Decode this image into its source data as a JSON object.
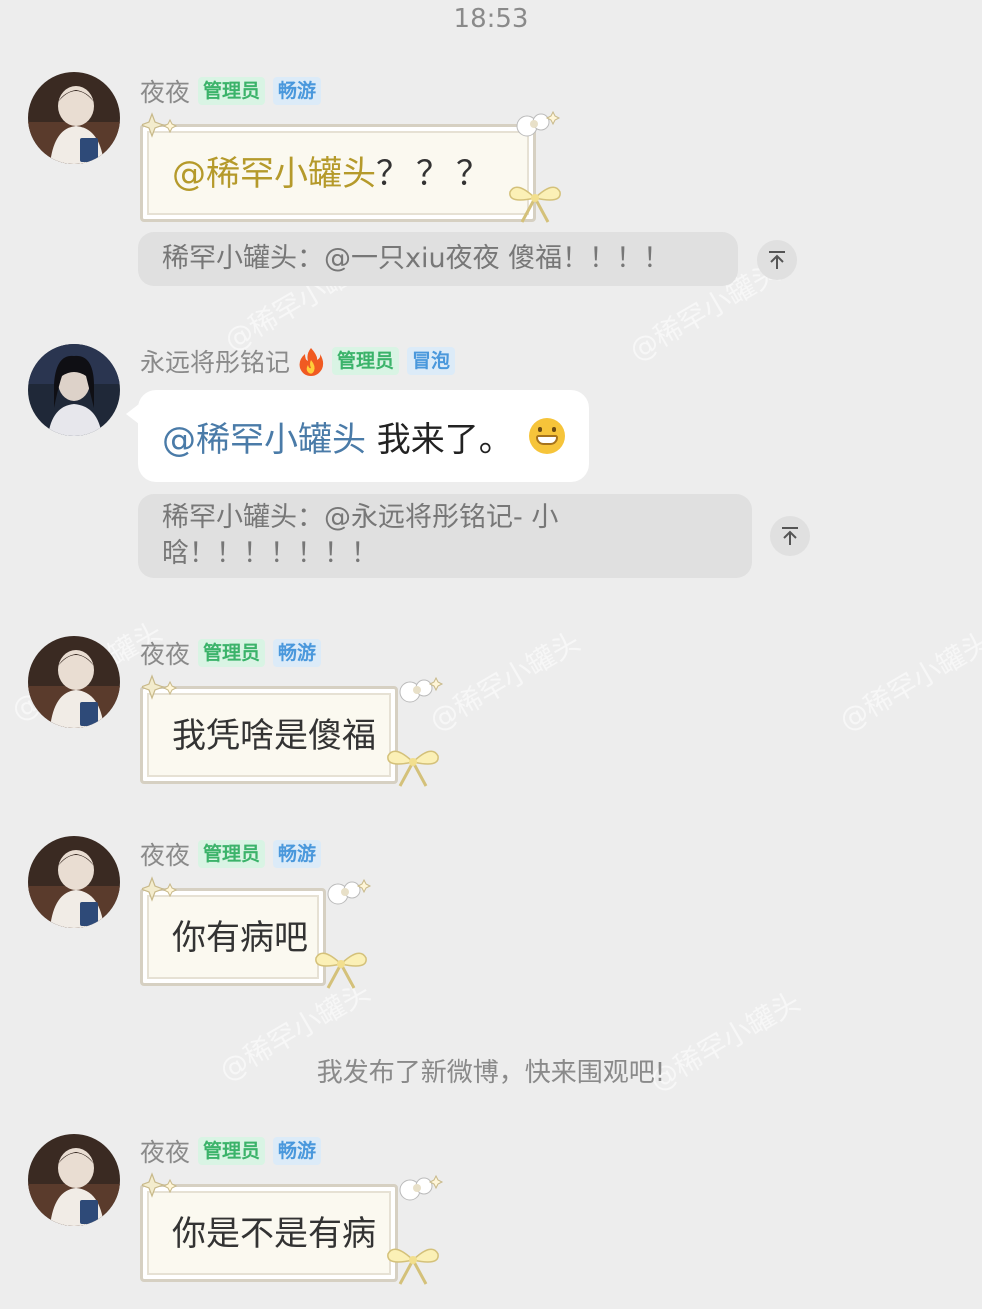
{
  "status_time": "18:53",
  "watermark_text": "@稀罕小罐头",
  "messages": [
    {
      "sender": "夜夜",
      "badges": [
        "管理员",
        "畅游"
      ],
      "mention": "@稀罕小罐头",
      "text": " ？？？",
      "quote": "稀罕小罐头：@一只xiu夜夜 傻福！！！！"
    },
    {
      "sender": "永远将彤铭记",
      "sender_emoji": "fire-icon",
      "badges": [
        "管理员",
        "冒泡"
      ],
      "mention": "@稀罕小罐头",
      "text": " 我来了。",
      "quote_line1": "稀罕小罐头：@永远将彤铭记- 小",
      "quote_line2": "晗！！！！！！！"
    },
    {
      "sender": "夜夜",
      "badges": [
        "管理员",
        "畅游"
      ],
      "text": "我凭啥是傻福"
    },
    {
      "sender": "夜夜",
      "badges": [
        "管理员",
        "畅游"
      ],
      "text": "你有病吧"
    },
    {
      "sender": "夜夜",
      "badges": [
        "管理员",
        "畅游"
      ],
      "text": "你是不是有病"
    }
  ],
  "system_notice": "我发布了新微博，快来围观吧!",
  "pin_icon": "pin-top-icon",
  "colors": {
    "background": "#ededed",
    "admin_badge": "#3bb36a",
    "level_badge": "#4a98dc",
    "mention_gold": "#b59a2b",
    "mention_blue": "#4a7ba8"
  }
}
